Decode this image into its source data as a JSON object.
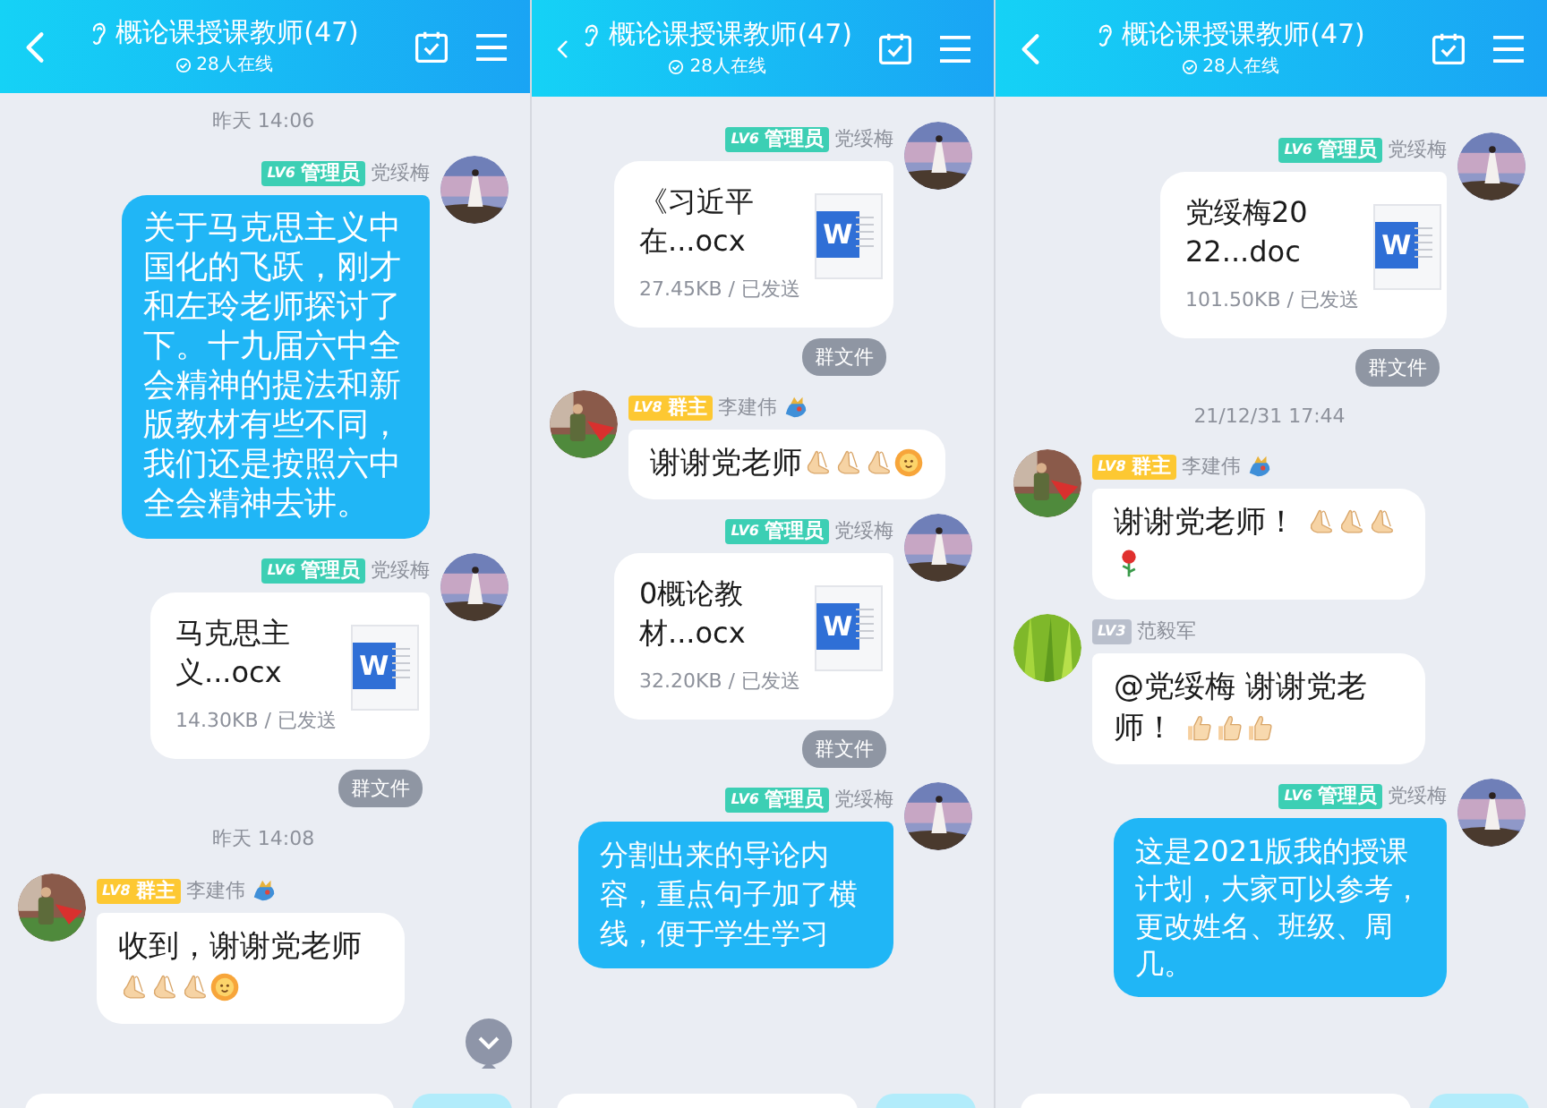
{
  "panels": [
    {
      "header": {
        "title": "概论课授课教师(47)",
        "online": "28人在线"
      },
      "scroll_down": true,
      "items": [
        {
          "kind": "time",
          "text": "昨天 14:06"
        },
        {
          "kind": "text_message",
          "outgoing": true,
          "level": "LV6",
          "role": "管理员",
          "color": "#3ccfb4",
          "name": "党绥梅",
          "segments": [
            {
              "kind": "text",
              "text": "关于马克思主义中国化的飞跃，刚才和左玲老师探讨了下。十九届六中全会精神的提法和新版教材有些不同，我们还是按照六中全会精神去讲。"
            }
          ]
        },
        {
          "kind": "file_message",
          "outgoing": true,
          "level": "LV6",
          "role": "管理员",
          "color": "#3ccfb4",
          "name": "党绥梅",
          "file_name": "马克思主义...ocx",
          "file_meta": "14.30KB / 已发送",
          "file_icon_text": "W"
        },
        {
          "kind": "group_file",
          "text": "群文件"
        },
        {
          "kind": "time",
          "text": "昨天 14:08"
        },
        {
          "kind": "text_message",
          "outgoing": false,
          "level": "LV8",
          "role": "群主",
          "color": "#fdc832",
          "name": "李建伟",
          "name_icon": true,
          "segments": [
            {
              "kind": "text",
              "text": "收到，谢谢党老师"
            },
            {
              "kind": "pray"
            },
            {
              "kind": "pray"
            },
            {
              "kind": "pray"
            },
            {
              "kind": "sun"
            }
          ]
        }
      ]
    },
    {
      "header": {
        "title": "概论课授课教师(47)",
        "online": "28人在线"
      },
      "items": [
        {
          "kind": "file_message",
          "outgoing": true,
          "level": "LV6",
          "role": "管理员",
          "color": "#3ccfb4",
          "name": "党绥梅",
          "file_name": "《习近平在...ocx",
          "file_meta": "27.45KB / 已发送",
          "file_icon_text": "W"
        },
        {
          "kind": "group_file",
          "text": "群文件"
        },
        {
          "kind": "text_message",
          "outgoing": false,
          "level": "LV8",
          "role": "群主",
          "color": "#fdc832",
          "name": "李建伟",
          "name_icon": true,
          "segments": [
            {
              "kind": "text",
              "text": "谢谢党老师"
            },
            {
              "kind": "pray"
            },
            {
              "kind": "pray"
            },
            {
              "kind": "pray"
            },
            {
              "kind": "sun"
            }
          ]
        },
        {
          "kind": "file_message",
          "outgoing": true,
          "level": "LV6",
          "role": "管理员",
          "color": "#3ccfb4",
          "name": "党绥梅",
          "file_name": "0概论教材...ocx",
          "file_meta": "32.20KB / 已发送",
          "file_icon_text": "W"
        },
        {
          "kind": "group_file",
          "text": "群文件"
        },
        {
          "kind": "text_message",
          "outgoing": true,
          "level": "LV6",
          "role": "管理员",
          "color": "#3ccfb4",
          "name": "党绥梅",
          "segments": [
            {
              "kind": "text",
              "text": "分割出来的导论内容，重点句子加了横线，便于学生学习"
            }
          ]
        }
      ]
    },
    {
      "header": {
        "title": "概论课授课教师(47)",
        "online": "28人在线"
      },
      "items": [
        {
          "kind": "file_message",
          "outgoing": true,
          "level": "LV6",
          "role": "管理员",
          "color": "#3ccfb4",
          "name": "党绥梅",
          "file_name": "党绥梅2022...doc",
          "file_meta": "101.50KB / 已发送",
          "file_icon_text": "W"
        },
        {
          "kind": "group_file",
          "text": "群文件"
        },
        {
          "kind": "time",
          "text": "21/12/31 17:44"
        },
        {
          "kind": "text_message",
          "outgoing": false,
          "level": "LV8",
          "role": "群主",
          "color": "#fdc832",
          "name": "李建伟",
          "name_icon": true,
          "segments": [
            {
              "kind": "text",
              "text": "谢谢党老师！ "
            },
            {
              "kind": "pray"
            },
            {
              "kind": "pray"
            },
            {
              "kind": "pray"
            },
            {
              "kind": "rose"
            }
          ]
        },
        {
          "kind": "text_message",
          "outgoing": false,
          "level": "LV3",
          "color": "#b9bfcc",
          "name": "范毅军",
          "segments": [
            {
              "kind": "text",
              "text": "@党绥梅 谢谢党老师！ "
            },
            {
              "kind": "thumb"
            },
            {
              "kind": "thumb"
            },
            {
              "kind": "thumb"
            }
          ]
        },
        {
          "kind": "text_message",
          "outgoing": true,
          "level": "LV6",
          "role": "管理员",
          "color": "#3ccfb4",
          "name": "党绥梅",
          "segments": [
            {
              "kind": "text",
              "text": "这是2021版我的授课计划，大家可以参考，更改姓名、班级、周几。"
            }
          ]
        }
      ]
    }
  ]
}
